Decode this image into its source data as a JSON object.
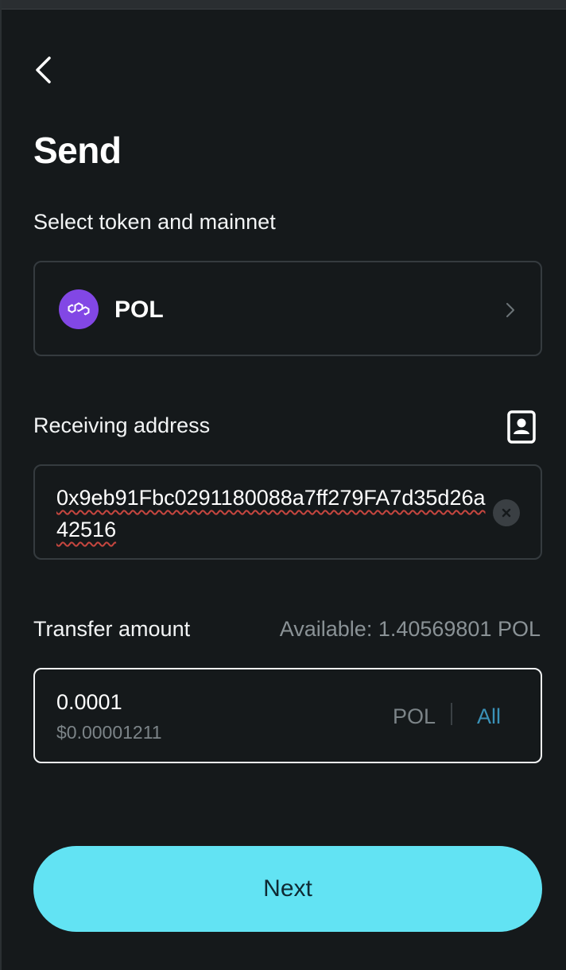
{
  "header": {
    "title": "Send"
  },
  "token": {
    "section_label": "Select token and mainnet",
    "name": "POL",
    "icon": "polygon-logo-icon"
  },
  "address": {
    "section_label": "Receiving address",
    "value": "0x9eb91Fbc0291180088a7ff279FA7d35d26a42516",
    "contact_icon": "address-book-icon"
  },
  "amount": {
    "section_label": "Transfer amount",
    "available": "Available: 1.40569801 POL",
    "value": "0.0001",
    "usd_value": "$0.00001211",
    "unit": "POL",
    "all_label": "All"
  },
  "footer": {
    "next_label": "Next"
  },
  "colors": {
    "background": "#15191b",
    "accent": "#62e3f3",
    "polygon_purple": "#8247e5",
    "link_blue": "#3a91b7"
  }
}
